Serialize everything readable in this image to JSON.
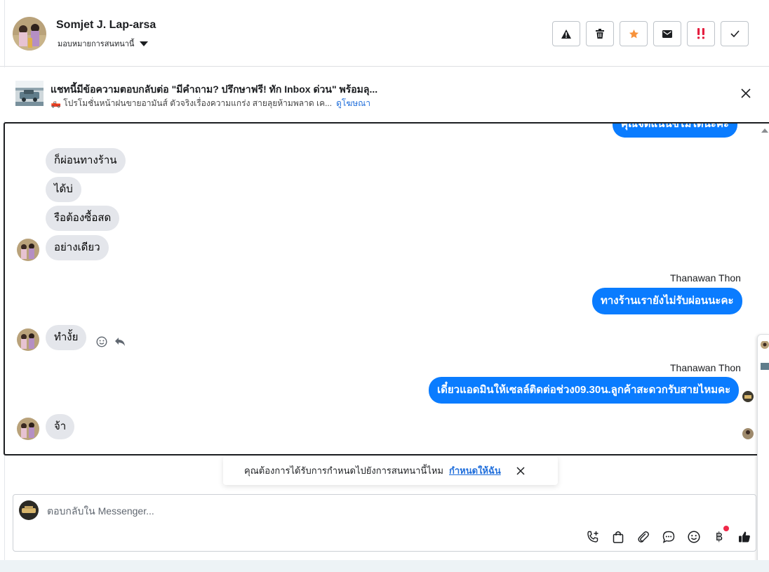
{
  "header": {
    "contact_name": "Somjet J. Lap-arsa",
    "assign_label": "มอบหมายการสนทนานี้",
    "actions": [
      {
        "name": "report-spam-button",
        "icon": "warning-icon"
      },
      {
        "name": "delete-button",
        "icon": "trash-icon"
      },
      {
        "name": "star-button",
        "icon": "star-icon",
        "color": "#f7923b"
      },
      {
        "name": "mark-unread-button",
        "icon": "envelope-icon"
      },
      {
        "name": "follow-up-button",
        "icon": "double-exclamation-icon",
        "color": "#e41e3f"
      },
      {
        "name": "mark-done-button",
        "icon": "check-icon"
      }
    ]
  },
  "ad": {
    "title": "แชทนี้มีข้อความตอบกลับต่อ \"มีคำถาม? ปรึกษาฟรี! ทัก Inbox ด่วน\" พร้อมลุ...",
    "subtitle": "🛻 โปรโมชั่นหน้าฝนขายอามันส์ ตัวจริงเรื่องความแกร่ง สายลุยห้ามพลาด เค...",
    "link": "ดูโฆษณา"
  },
  "messages": {
    "partial_top": "คุณจัดแน่นข้ไม่ได้นะคะ",
    "in_1": "ก็ผ่อนทางร้าน",
    "in_2": "ได้บ่",
    "in_3": "รือต้องซื้อสด",
    "in_4": "อย่างเดียว",
    "sender_1": "Thanawan Thon",
    "out_1": "ทางร้านเรายังไม่รับผ่อนนะคะ",
    "in_5": "ทำงั้ย",
    "sender_2": "Thanawan Thon",
    "out_2": "เดี๋ยวแอดมินให้เซลล์ติดต่อช่วง09.30น.ลูกค้าสะดวกรับสายไหมคะ",
    "in_6": "จ้า"
  },
  "toast": {
    "text": "คุณต้องการได้รับการกำหนดไปยังการสนทนานี้ไหม",
    "link": "กำหนดให้ฉัน"
  },
  "composer": {
    "placeholder": "ตอบกลับใน Messenger...",
    "tools": [
      "call-plus-icon",
      "shopping-bag-icon",
      "attachment-icon",
      "chat-bubble-icon",
      "emoji-icon",
      "baht-icon",
      "thumbs-up-icon"
    ],
    "baht_symbol": "฿"
  },
  "colors": {
    "outgoing_bubble": "#0a7cff",
    "incoming_bubble": "#e4e6eb",
    "link": "#216fdb"
  }
}
